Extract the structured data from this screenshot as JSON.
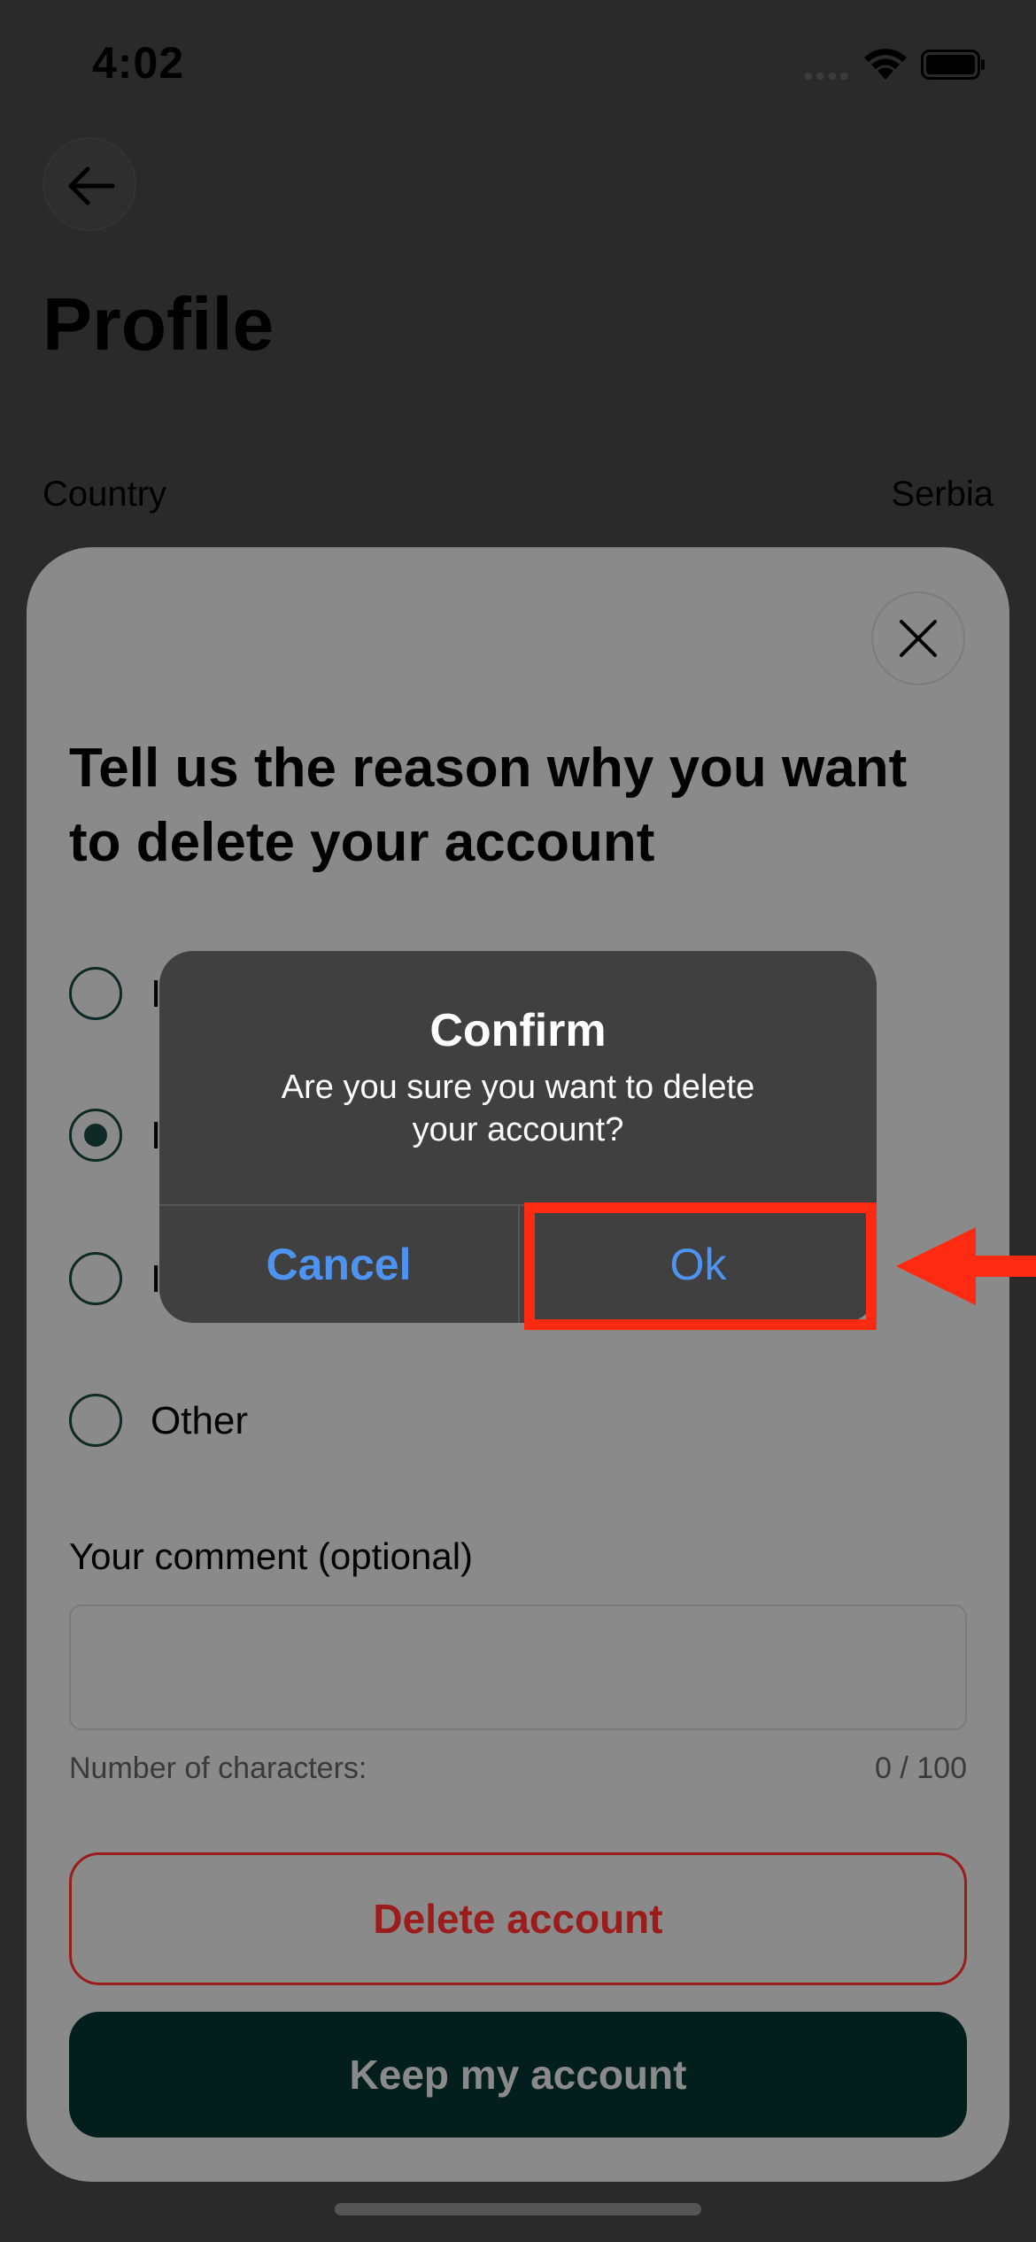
{
  "status_bar": {
    "time": "4:02",
    "icons": [
      "cellular-dots-icon",
      "wifi-icon",
      "battery-icon"
    ]
  },
  "page": {
    "title": "Profile",
    "back_icon": "arrow-left-icon",
    "country_label": "Country",
    "country_value": "Serbia"
  },
  "sheet": {
    "close_icon": "close-icon",
    "heading": "Tell us the reason why you want to delete your account",
    "reasons": [
      {
        "label": "I",
        "selected": false
      },
      {
        "label": "I",
        "selected": true
      },
      {
        "label": "I",
        "selected": false
      },
      {
        "label": "Other",
        "selected": false
      }
    ],
    "comment_label": "Your comment (optional)",
    "comment_value": "",
    "char_label": "Number of characters:",
    "char_count": "0 / 100",
    "delete_label": "Delete account",
    "keep_label": "Keep my account"
  },
  "alert": {
    "title": "Confirm",
    "message": "Are you sure you want to delete your account?",
    "cancel_label": "Cancel",
    "ok_label": "Ok"
  },
  "colors": {
    "accent_blue": "#4f93f0",
    "danger_red": "#9b1c1c",
    "highlight_red": "#ff2a12",
    "keep_button_bg": "#021f1d",
    "sheet_bg": "#8a8a8a",
    "alert_bg": "#404040"
  }
}
